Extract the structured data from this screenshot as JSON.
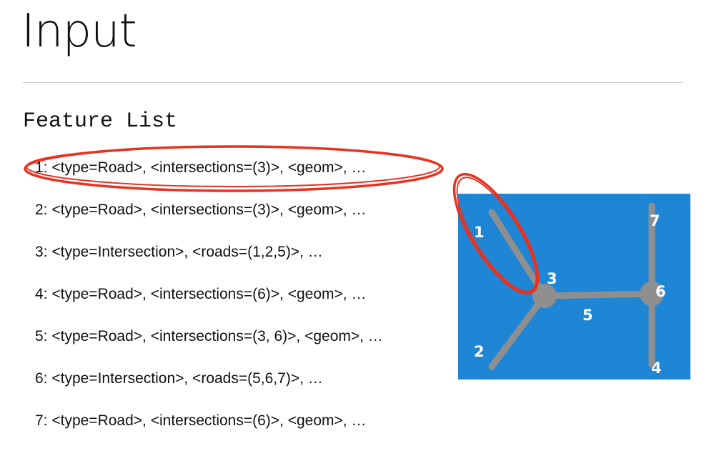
{
  "title": "Input",
  "section_heading": "Feature List",
  "features": [
    "1: <type=Road>, <intersections=(3)>, <geom>, …",
    "2: <type=Road>, <intersections=(3)>, <geom>, …",
    "3: <type=Intersection>, <roads=(1,2,5)>, …",
    "4: <type=Road>, <intersections=(6)>, <geom>, …",
    "5: <type=Road>, <intersections=(3, 6)>, <geom>, …",
    "6: <type=Intersection>, <roads=(5,6,7)>, …",
    "7: <type=Road>, <intersections=(6)>, <geom>, …"
  ],
  "map": {
    "labels": {
      "n1": "1",
      "n2": "2",
      "n3": "3",
      "n4": "4",
      "n5": "5",
      "n6": "6",
      "n7": "7"
    },
    "colors": {
      "background": "#1f86d6",
      "road": "#8f8f8f",
      "label": "#ffffff",
      "highlight": "#e8321f"
    }
  }
}
